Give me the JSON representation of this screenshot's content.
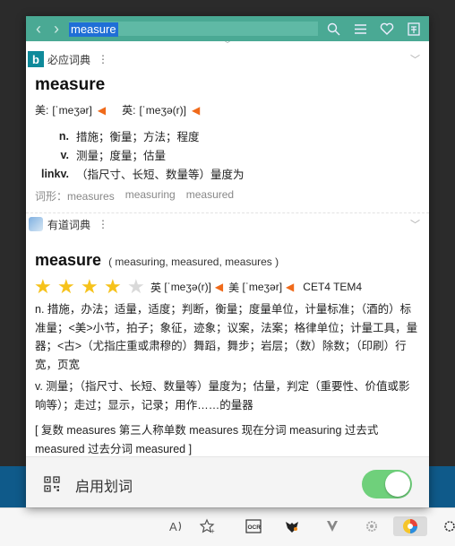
{
  "popup": {
    "search_value": "measure",
    "toolbar_icons": [
      "search-icon",
      "menu-icon",
      "heart-icon",
      "book-icon"
    ]
  },
  "bing": {
    "source_label": "必应词典",
    "word": "measure",
    "us_label": "美:",
    "us_pron": "[ˈmeʒər]",
    "uk_label": "英:",
    "uk_pron": "[ˈmeʒə(r)]",
    "definitions": [
      {
        "pos": "n.",
        "text": "措施；衡量；方法；程度"
      },
      {
        "pos": "v.",
        "text": "测量；度量；估量"
      },
      {
        "pos": "linkv.",
        "text": "（指尺寸、长短、数量等）量度为"
      }
    ],
    "forms_label": "词形：",
    "forms": [
      "measures",
      "measuring",
      "measured"
    ]
  },
  "youdao": {
    "source_label": "有道词典",
    "word": "measure",
    "inflections": "( measuring, measured, measures )",
    "stars": 4,
    "stars_max": 5,
    "uk_label": "英",
    "uk_pron": "[ˈmeʒə(r)]",
    "us_label": "美",
    "us_pron": "[ˈmeʒər]",
    "level": "CET4 TEM4",
    "noun_def": "n. 措施，办法；适量，适度；判断，衡量；度量单位，计量标准；（酒的）标准量；<美>小节，拍子；象征，迹象；议案，法案；格律单位；计量工具，量器；<古>（尤指庄重或肃穆的）舞蹈，舞步；岩层；（数）除数；（印刷）行宽，页宽",
    "verb_def": "v. 测量；（指尺寸、长短、数量等）量度为；估量，判定（重要性、价值或影响等）；走过；显示，记录；用作……的量器",
    "forms_note": "[ 复数 measures 第三人称单数 measures 现在分词 measuring 过去式 measured 过去分词 measured ]"
  },
  "footer": {
    "label": "启用划词",
    "toggle_on": true
  },
  "browser_bar": {
    "icons": [
      "read-aloud-icon",
      "favorites-icon",
      "ocr-extension-icon",
      "fox-extension-icon",
      "v-extension-icon",
      "gear-extension-icon",
      "dictionary-extension-icon",
      "settings-icon"
    ],
    "ocr_label": "OCR"
  },
  "colors": {
    "accent": "#4aa994",
    "toggle": "#6fd07b",
    "star": "#f6c21b",
    "speaker": "#f06a1a"
  }
}
